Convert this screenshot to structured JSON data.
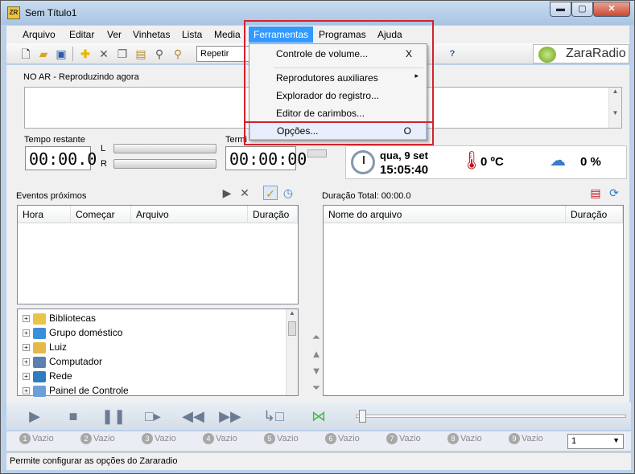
{
  "window": {
    "title": "Sem Título1",
    "icon_label": "ZR",
    "minimize": "▬",
    "maximize": "▢",
    "close": "✕"
  },
  "menu": [
    {
      "label": "Arquivo"
    },
    {
      "label": "Editar"
    },
    {
      "label": "Ver"
    },
    {
      "label": "Vinhetas"
    },
    {
      "label": "Lista"
    },
    {
      "label": "Media"
    },
    {
      "label": "Ferramentas"
    },
    {
      "label": "Programas"
    },
    {
      "label": "Ajuda"
    }
  ],
  "toolbar": {
    "repeat_value": "Repetir",
    "brand": "ZaraRadio"
  },
  "dropdown": {
    "items": [
      {
        "label": "Controle de volume...",
        "shortcut": "X"
      },
      {
        "label": "Reprodutores auxiliares",
        "submenu": "▸"
      },
      {
        "label": "Explorador do registro..."
      },
      {
        "label": "Editor de carimbos..."
      },
      {
        "label": "Opções...",
        "shortcut": "O"
      }
    ]
  },
  "onair": {
    "label": "NO AR - Reproduzindo agora"
  },
  "timers": {
    "remaining_label": "Tempo restante",
    "remaining_value": "00:00.0",
    "channel_l": "L",
    "channel_r": "R",
    "end_label": "Termi",
    "end_value": "00:00:00"
  },
  "info": {
    "date": "qua, 9 set",
    "time": "15:05:40",
    "temperature": "0 ºC",
    "humidity": "0 %"
  },
  "events": {
    "label": "Eventos próximos",
    "columns": [
      "Hora",
      "Começar",
      "Arquivo",
      "Duração"
    ]
  },
  "playlist": {
    "total_label": "Duração Total: 00:00.0",
    "columns": [
      "Nome do arquivo",
      "Duração"
    ]
  },
  "tree": [
    {
      "label": "Bibliotecas",
      "color": "#e9c44a"
    },
    {
      "label": "Grupo doméstico",
      "color": "#3b8edb"
    },
    {
      "label": "Luiz",
      "color": "#e4b84a"
    },
    {
      "label": "Computador",
      "color": "#5a7fb0"
    },
    {
      "label": "Rede",
      "color": "#2f7bc1"
    },
    {
      "label": "Painel de Controle",
      "color": "#6aa0d8"
    }
  ],
  "slots": [
    {
      "num": "1",
      "label": "Vazio"
    },
    {
      "num": "2",
      "label": "Vazio"
    },
    {
      "num": "3",
      "label": "Vazio"
    },
    {
      "num": "4",
      "label": "Vazio"
    },
    {
      "num": "5",
      "label": "Vazio"
    },
    {
      "num": "6",
      "label": "Vazio"
    },
    {
      "num": "7",
      "label": "Vazio"
    },
    {
      "num": "8",
      "label": "Vazio"
    },
    {
      "num": "9",
      "label": "Vazio"
    }
  ],
  "slot_combo": "1",
  "status": {
    "text": "Permite configurar as opções do Zararadio"
  },
  "colors": {
    "menu_highlight": "#3399ff",
    "annotation_red": "#d4212b"
  }
}
